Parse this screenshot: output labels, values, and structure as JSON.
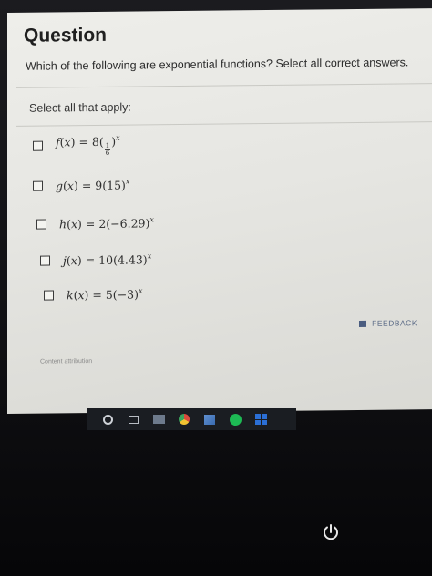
{
  "question": {
    "title": "Question",
    "prompt": "Which of the following are exponential functions? Select all correct answers.",
    "instruction": "Select all that apply:"
  },
  "options": [
    {
      "fn": "f",
      "var": "x",
      "coef": "8",
      "base_num": "1",
      "base_den": "6",
      "exp": "x"
    },
    {
      "fn": "g",
      "var": "x",
      "coef": "9",
      "base": "15",
      "exp": "x"
    },
    {
      "fn": "h",
      "var": "x",
      "coef": "2",
      "base": "−6.29",
      "exp": "x"
    },
    {
      "fn": "j",
      "var": "x",
      "coef": "10",
      "base": "4.43",
      "exp": "x"
    },
    {
      "fn": "k",
      "var": "x",
      "coef": "5",
      "base": "−3",
      "exp": "x"
    }
  ],
  "footer": {
    "feedback_label": "FEEDBACK",
    "attribution": "Content attribution"
  },
  "taskbar": {
    "icons": [
      "cortana-circle-icon",
      "task-view-icon",
      "store-icon",
      "chrome-icon",
      "photos-icon",
      "spotify-icon",
      "windows-icon"
    ]
  },
  "colors": {
    "screen_bg": "#e9e9e5",
    "text": "#202020",
    "feedback": "#5a6a86",
    "taskbar": "#1a1d22"
  }
}
